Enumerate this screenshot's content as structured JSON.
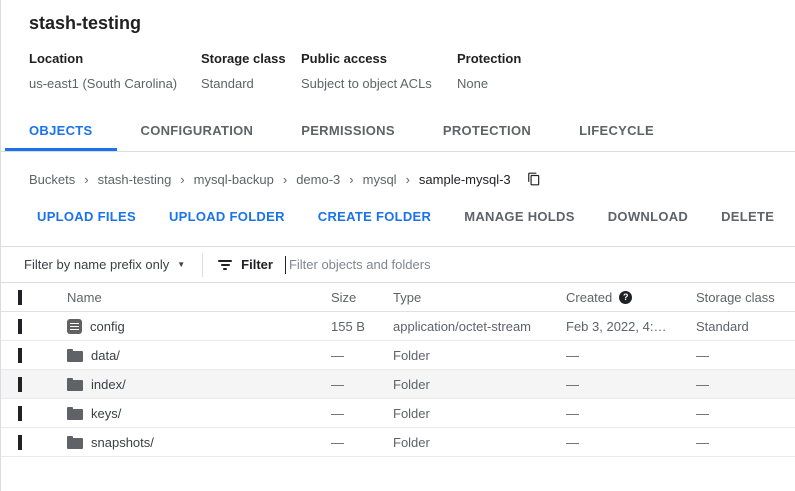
{
  "header": {
    "title": "stash-testing",
    "info": [
      {
        "label": "Location",
        "value": "us-east1 (South Carolina)"
      },
      {
        "label": "Storage class",
        "value": "Standard"
      },
      {
        "label": "Public access",
        "value": "Subject to object ACLs"
      },
      {
        "label": "Protection",
        "value": "None"
      }
    ]
  },
  "tabs": [
    {
      "label": "OBJECTS",
      "active": true
    },
    {
      "label": "CONFIGURATION",
      "active": false
    },
    {
      "label": "PERMISSIONS",
      "active": false
    },
    {
      "label": "PROTECTION",
      "active": false
    },
    {
      "label": "LIFECYCLE",
      "active": false
    }
  ],
  "breadcrumb": {
    "items": [
      "Buckets",
      "stash-testing",
      "mysql-backup",
      "demo-3",
      "mysql"
    ],
    "current": "sample-mysql-3"
  },
  "actions": [
    {
      "label": "UPLOAD FILES",
      "enabled": true
    },
    {
      "label": "UPLOAD FOLDER",
      "enabled": true
    },
    {
      "label": "CREATE FOLDER",
      "enabled": true
    },
    {
      "label": "MANAGE HOLDS",
      "enabled": false
    },
    {
      "label": "DOWNLOAD",
      "enabled": false
    },
    {
      "label": "DELETE",
      "enabled": false
    }
  ],
  "filter_bar": {
    "scope_label": "Filter by name prefix only",
    "filter_label": "Filter",
    "input_value": "",
    "placeholder": "Filter objects and folders"
  },
  "table": {
    "columns": [
      "Name",
      "Size",
      "Type",
      "Created",
      "Storage class"
    ],
    "rows": [
      {
        "icon": "file",
        "name": "config",
        "size": "155 B",
        "type": "application/octet-stream",
        "created": "Feb 3, 2022, 4:…",
        "storage_class": "Standard"
      },
      {
        "icon": "folder",
        "name": "data/",
        "size": "—",
        "type": "Folder",
        "created": "—",
        "storage_class": "—"
      },
      {
        "icon": "folder",
        "name": "index/",
        "size": "—",
        "type": "Folder",
        "created": "—",
        "storage_class": "—"
      },
      {
        "icon": "folder",
        "name": "keys/",
        "size": "—",
        "type": "Folder",
        "created": "—",
        "storage_class": "—"
      },
      {
        "icon": "folder",
        "name": "snapshots/",
        "size": "—",
        "type": "Folder",
        "created": "—",
        "storage_class": "—"
      }
    ]
  },
  "icons": {
    "chevron_right": "›",
    "dropdown_arrow": "▼",
    "help": "?"
  },
  "colors": {
    "accent": "#1a73e8",
    "text_dark": "#212121",
    "text_gray": "#5f6368",
    "border": "#dadce0",
    "hover_row": "#f5f5f5"
  }
}
